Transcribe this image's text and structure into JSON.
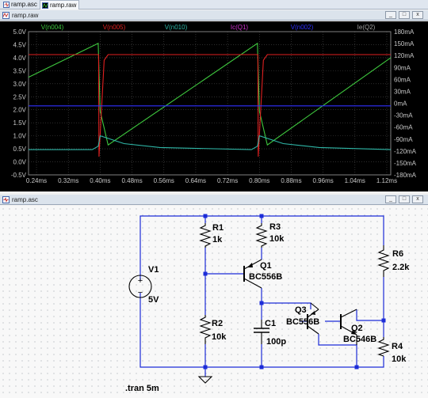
{
  "tabs": [
    {
      "label": "ramp.asc",
      "icon": "schematic-icon"
    },
    {
      "label": "ramp.raw",
      "icon": "waveform-icon"
    }
  ],
  "plot_window": {
    "title": "ramp.raw",
    "buttons": [
      "_",
      "□",
      "x"
    ]
  },
  "schematic_window": {
    "title": "ramp.asc",
    "buttons": [
      "_",
      "□",
      "x"
    ]
  },
  "colors": {
    "plot_bg": "#000000",
    "v_n004": "#3ec83e",
    "v_n005": "#e02020",
    "v_n010": "#2fb8a8",
    "ic_q1": "#d030d0",
    "v_n002": "#3030ff",
    "ie_q2": "#a0a0a0",
    "wire": "#1c2cd8",
    "schem_bg": "#f8f8f8"
  },
  "chart_data": {
    "type": "line",
    "legend": [
      "V(n004)",
      "V(n005)",
      "V(n010)",
      "Ic(Q1)",
      "V(n002)",
      "Ie(Q2)"
    ],
    "xlabel": "",
    "x_ticks": [
      "0.24ms",
      "0.32ms",
      "0.40ms",
      "0.48ms",
      "0.56ms",
      "0.64ms",
      "0.72ms",
      "0.80ms",
      "0.88ms",
      "0.96ms",
      "1.04ms",
      "1.12ms"
    ],
    "xlim": [
      0.22,
      1.13
    ],
    "y_left_ticks": [
      "5.0V",
      "4.5V",
      "4.0V",
      "3.5V",
      "3.0V",
      "2.5V",
      "2.0V",
      "1.5V",
      "1.0V",
      "0.5V",
      "0.0V",
      "-0.5V"
    ],
    "ylim_left": [
      -0.5,
      5.0
    ],
    "y_right_ticks": [
      "180mA",
      "150mA",
      "120mA",
      "90mA",
      "60mA",
      "30mA",
      "0mA",
      "-30mA",
      "-60mA",
      "-90mA",
      "-120mA",
      "-150mA",
      "-180mA"
    ],
    "ylim_right": [
      -180,
      180
    ],
    "series": [
      {
        "name": "V(n004)",
        "x": [
          0.22,
          0.395,
          0.4,
          0.42,
          0.795,
          0.8,
          0.82,
          1.13
        ],
        "y": [
          3.25,
          4.55,
          1.95,
          0.65,
          4.55,
          1.95,
          0.65,
          4.0
        ]
      },
      {
        "name": "V(n005)",
        "x": [
          0.22,
          0.396,
          0.397,
          0.41,
          0.42,
          0.796,
          0.797,
          0.81,
          0.82,
          1.13
        ],
        "y": [
          4.12,
          4.12,
          0.2,
          3.9,
          4.12,
          4.12,
          0.2,
          3.9,
          4.12,
          4.12
        ]
      },
      {
        "name": "V(n010)",
        "x": [
          0.22,
          0.38,
          0.395,
          0.4,
          0.42,
          0.46,
          0.55,
          0.78,
          0.795,
          0.8,
          0.82,
          0.86,
          0.95,
          1.13
        ],
        "y": [
          0.47,
          0.47,
          0.6,
          1.0,
          0.9,
          0.7,
          0.55,
          0.47,
          0.6,
          1.0,
          0.9,
          0.7,
          0.55,
          0.47
        ]
      },
      {
        "name": "V(n002)",
        "x": [
          0.22,
          1.13
        ],
        "y": [
          2.15,
          2.15
        ]
      }
    ]
  },
  "schematic": {
    "V1": {
      "ref": "V1",
      "value": "5V"
    },
    "R1": {
      "ref": "R1",
      "value": "1k"
    },
    "R2": {
      "ref": "R2",
      "value": "10k"
    },
    "R3": {
      "ref": "R3",
      "value": "10k"
    },
    "R4": {
      "ref": "R4",
      "value": "10k"
    },
    "R6": {
      "ref": "R6",
      "value": "2.2k"
    },
    "C1": {
      "ref": "C1",
      "value": "100p"
    },
    "Q1": {
      "ref": "Q1",
      "value": "BC556B"
    },
    "Q2": {
      "ref": "Q2",
      "value": "BC546B"
    },
    "Q3": {
      "ref": "Q3",
      "value": "BC556B"
    },
    "directive": ".tran 5m"
  }
}
